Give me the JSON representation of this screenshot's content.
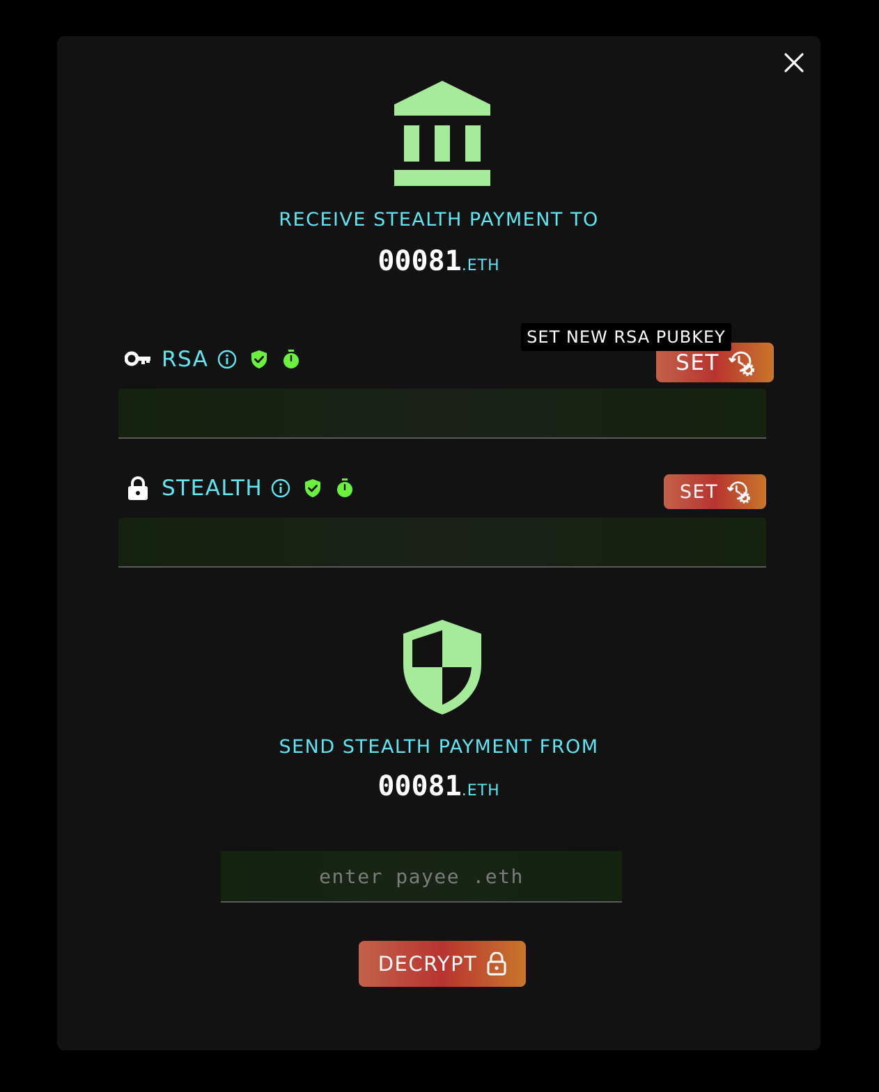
{
  "receive": {
    "heading": "RECEIVE STEALTH PAYMENT TO",
    "name": "00081",
    "tld": ".ETH"
  },
  "rsa": {
    "label": "RSA",
    "set_label": "SET",
    "tooltip": "SET NEW RSA PUBKEY"
  },
  "stealth": {
    "label": "STEALTH",
    "set_label": "SET"
  },
  "send": {
    "heading": "SEND STEALTH PAYMENT FROM",
    "name": "00081",
    "tld": ".ETH",
    "payee_placeholder": "enter payee .eth",
    "decrypt_label": "DECRYPT"
  },
  "icons": {
    "close": "close-icon",
    "bank": "bank-icon",
    "key": "key-icon",
    "lock": "lock-icon",
    "info": "info-icon",
    "verified": "verified-shield-icon",
    "timer": "timer-icon",
    "history_settings": "history-settings-icon",
    "security_shield": "security-shield-icon",
    "unlock": "unlock-icon"
  },
  "colors": {
    "accent_cyan": "#5ee6f2",
    "icon_green": "#a6eb9a",
    "status_green": "#6af23f",
    "button_gradient_start": "#c2614a",
    "button_gradient_mid": "#b8342f",
    "button_gradient_end": "#c9762c",
    "modal_bg": "#121212"
  }
}
